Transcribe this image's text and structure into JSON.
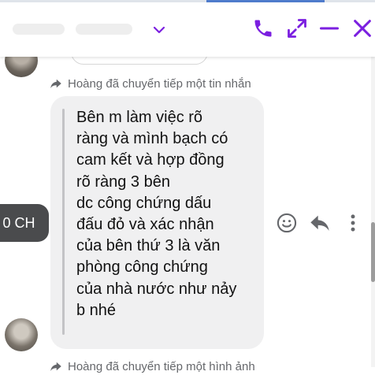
{
  "header": {
    "contact_name": "",
    "accent": "#7b1fe0",
    "icons": [
      "chevron-down-icon",
      "phone-icon",
      "maximize-icon",
      "minimize-icon",
      "close-icon"
    ]
  },
  "messages": {
    "forward_note": "Hoàng đã chuyển tiếp một tin nhắn",
    "forwarded_text": "Bên m làm việc rõ\nràng và mình bạch có\ncam kết và hợp đồng\nrõ ràng 3 bên\ndc công chứng dấu\nđấu đỏ và xác nhận\ncủa bên thứ 3 là văn\nphòng công chứng\ncủa nhà nước như nảy\nb nhé",
    "timestamp": "0 CH",
    "next_forward_note": "Hoàng đã chuyển tiếp một hình ảnh"
  },
  "actions": {
    "icons": [
      "smiley-icon",
      "reply-icon",
      "more-icon"
    ]
  }
}
